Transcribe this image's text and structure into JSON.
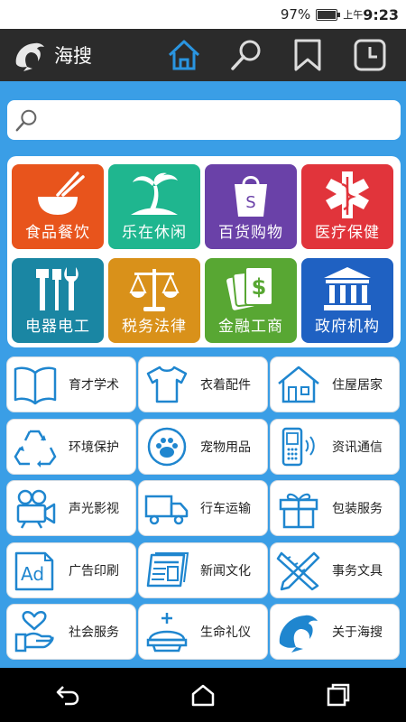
{
  "status_bar": {
    "battery": "97%",
    "battery_level": 0.97,
    "time_prefix": "上午",
    "time": "9:23"
  },
  "header": {
    "app_title": "海搜",
    "tabs": [
      "home-icon",
      "search-icon",
      "bookmark-icon",
      "history-icon"
    ],
    "active_tab": 0
  },
  "search": {
    "placeholder": ""
  },
  "categories": [
    {
      "label": "食品餐饮",
      "color": "#e8541c",
      "icon": "bowl-chopsticks-icon"
    },
    {
      "label": "乐在休闲",
      "color": "#1fb68f",
      "icon": "palm-tree-icon"
    },
    {
      "label": "百货购物",
      "color": "#6a41a8",
      "icon": "shopping-bag-icon"
    },
    {
      "label": "医疗保健",
      "color": "#e1343b",
      "icon": "medical-cross-icon"
    },
    {
      "label": "电器电工",
      "color": "#1a86a3",
      "icon": "tools-icon"
    },
    {
      "label": "税务法律",
      "color": "#d9911a",
      "icon": "scales-icon"
    },
    {
      "label": "金融工商",
      "color": "#58a733",
      "icon": "money-icon"
    },
    {
      "label": "政府机构",
      "color": "#1f61c2",
      "icon": "government-building-icon"
    }
  ],
  "services": [
    {
      "label": "育才学术",
      "icon": "book-icon"
    },
    {
      "label": "衣着配件",
      "icon": "tshirt-icon"
    },
    {
      "label": "住屋居家",
      "icon": "house-icon"
    },
    {
      "label": "环境保护",
      "icon": "recycle-icon"
    },
    {
      "label": "宠物用品",
      "icon": "paw-icon"
    },
    {
      "label": "资讯通信",
      "icon": "phone-icon"
    },
    {
      "label": "声光影视",
      "icon": "video-camera-icon"
    },
    {
      "label": "行车运输",
      "icon": "truck-icon"
    },
    {
      "label": "包装服务",
      "icon": "gift-icon"
    },
    {
      "label": "广告印刷",
      "icon": "ad-icon"
    },
    {
      "label": "新闻文化",
      "icon": "newspaper-icon"
    },
    {
      "label": "事务文具",
      "icon": "ruler-pencil-icon"
    },
    {
      "label": "社会服务",
      "icon": "hand-heart-icon"
    },
    {
      "label": "生命礼仪",
      "icon": "ceremony-icon"
    },
    {
      "label": "关于海搜",
      "icon": "dolphin-icon"
    }
  ],
  "colors": {
    "background": "#3a9ee6",
    "header": "#2b2b2b",
    "accent": "#2a95e0",
    "icon_blue": "#1f86cf"
  }
}
